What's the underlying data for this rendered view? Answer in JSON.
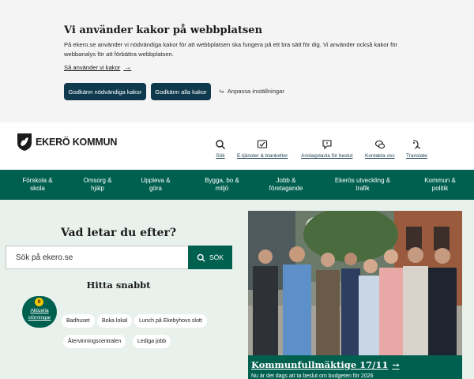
{
  "cookie": {
    "title": "Vi använder kakor på webbplatsen",
    "text": "På ekero.se använder vi nödvändiga kakor för att webbplatsen ska fungera på ett bra sätt för dig. Vi använder också kakor för webbanalys för att förbättra webbplatsen.",
    "link": "Så använder vi kakor",
    "accept_necessary": "Godkänn nödvändiga kakor",
    "accept_all": "Godkänn alla kakor",
    "customize": "Anpassa inställningar"
  },
  "header": {
    "logo_text": "EKERÖ KOMMUN",
    "utility": [
      {
        "label": "Sök",
        "icon": "search-icon"
      },
      {
        "label": "E-tjänster & blanketter",
        "icon": "e-services-icon"
      },
      {
        "label": "Anslagstavla för beslut",
        "icon": "notice-board-icon"
      },
      {
        "label": "Kontakta oss",
        "icon": "chat-icon"
      },
      {
        "label": "Translate",
        "icon": "translate-icon"
      }
    ]
  },
  "nav": {
    "items": [
      {
        "line1": "Förskola &",
        "line2": "skola"
      },
      {
        "line1": "Omsorg &",
        "line2": "hjälp"
      },
      {
        "line1": "Uppleva &",
        "line2": "göra"
      },
      {
        "line1": "Bygga, bo &",
        "line2": "miljö"
      },
      {
        "line1": "Jobb &",
        "line2": "företagande"
      },
      {
        "line1": "Ekerös utveckling &",
        "line2": "trafik"
      },
      {
        "line1": "Kommun &",
        "line2": "politik"
      }
    ]
  },
  "search": {
    "title": "Vad letar du efter?",
    "placeholder": "Sök på ekero.se",
    "button": "SÖK"
  },
  "quick": {
    "title": "Hitta snabbt",
    "status_count": "0",
    "status_line1": "Aktuella",
    "status_line2": "störningar",
    "chips": [
      "Badhuset",
      "Boka lokal",
      "Lunch på Ekebyhovs slott",
      "Återvinningscentralen",
      "Lediga jobb"
    ]
  },
  "feature": {
    "title": "Kommunfullmäktige 17/11",
    "subtitle": "Nu är det dags att ta beslut om budgeten för 2026"
  },
  "colors": {
    "primary_green": "#00604f",
    "dark_blue": "#0f3a4e",
    "badge_yellow": "#f5c400",
    "page_bg": "#e8f1ec"
  }
}
